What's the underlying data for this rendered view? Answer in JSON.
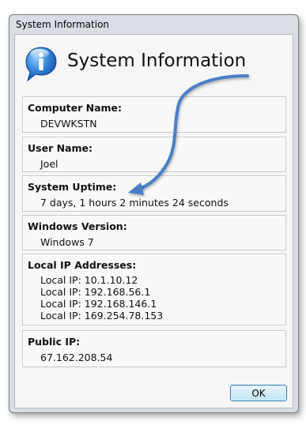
{
  "window": {
    "title": "System Information"
  },
  "header": {
    "title": "System Information",
    "icon": "info-speech-bubble-icon"
  },
  "sections": {
    "computer_name": {
      "label": "Computer Name:",
      "value": "DEVWKSTN"
    },
    "user_name": {
      "label": "User Name:",
      "value": "Joel"
    },
    "system_uptime": {
      "label": "System Uptime:",
      "value": "7 days, 1 hours 2 minutes 24 seconds"
    },
    "windows_version": {
      "label": "Windows Version:",
      "value": "Windows 7"
    },
    "local_ip": {
      "label": "Local IP Addresses:",
      "lines": [
        "Local IP: 10.1.10.12",
        "Local IP: 192.168.56.1",
        "Local IP: 192.168.146.1",
        "Local IP: 169.254.78.153"
      ]
    },
    "public_ip": {
      "label": "Public IP:",
      "value": "67.162.208.54"
    }
  },
  "buttons": {
    "ok_label": "OK"
  },
  "colors": {
    "accent": "#3d7fc4",
    "icon_blue": "#2f7fd3",
    "arrow_blue": "#4a7fc8"
  }
}
